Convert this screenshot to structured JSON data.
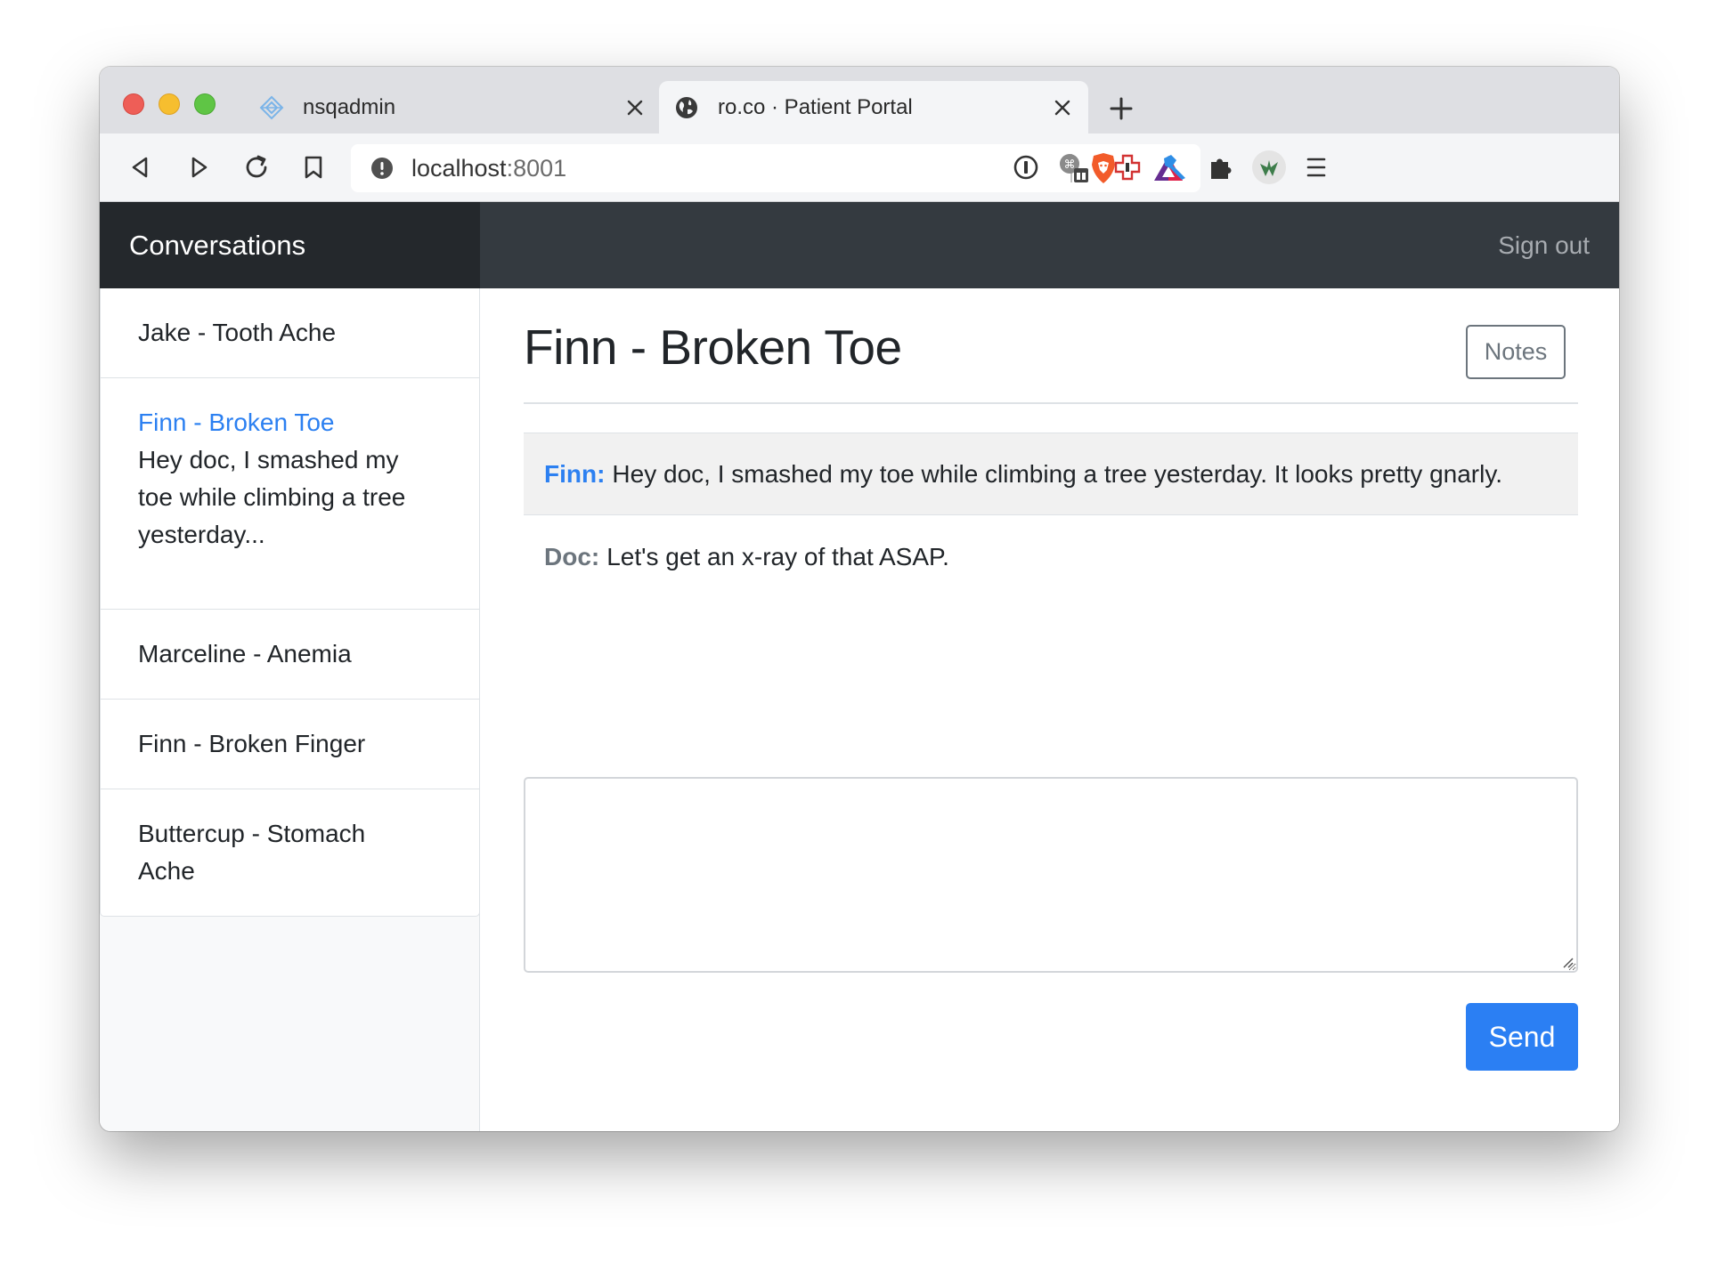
{
  "browser": {
    "tabs": [
      {
        "title": "nsqadmin",
        "active": false,
        "favicon": "nsq-diamond-icon"
      },
      {
        "title": "ro.co · Patient Portal",
        "active": true,
        "favicon": "globe-icon"
      }
    ],
    "address_bar": {
      "host": "localhost",
      "port": ":8001"
    },
    "extension_icons": [
      "brave-shield-icon",
      "bat-triangle-icon",
      "1password-icon",
      "shortcut-extension-icon",
      "medical-cross-icon",
      "wrench-icon",
      "puzzle-icon",
      "profile-avatar-icon",
      "menu-icon"
    ]
  },
  "app": {
    "brand": "Conversations",
    "signout_label": "Sign out",
    "conversations": [
      {
        "title": "Jake - Tooth Ache",
        "preview": ""
      },
      {
        "title": "Finn - Broken Toe",
        "preview": "Hey doc, I smashed my toe while climbing a tree yesterday..."
      },
      {
        "title": "Marceline - Anemia",
        "preview": ""
      },
      {
        "title": "Finn - Broken Finger",
        "preview": ""
      },
      {
        "title": "Buttercup - Stomach Ache",
        "preview": ""
      }
    ],
    "active_conversation": "Finn - Broken Toe",
    "notes_label": "Notes",
    "messages": [
      {
        "author": "Finn:",
        "text": "Hey doc, I smashed my toe while climbing a tree yesterday. It looks pretty gnarly."
      },
      {
        "author": "Doc:",
        "text": "Let's get an x-ray of that ASAP."
      }
    ],
    "reply": {
      "value": "",
      "placeholder": ""
    },
    "send_label": "Send"
  },
  "colors": {
    "accent": "#2c80f1",
    "navbar": "#343a40",
    "brand_bg": "#24282c",
    "sidebar_bg": "#f8f9fa",
    "patient_message_bg": "#f1f1f1",
    "muted": "#6c757d"
  }
}
